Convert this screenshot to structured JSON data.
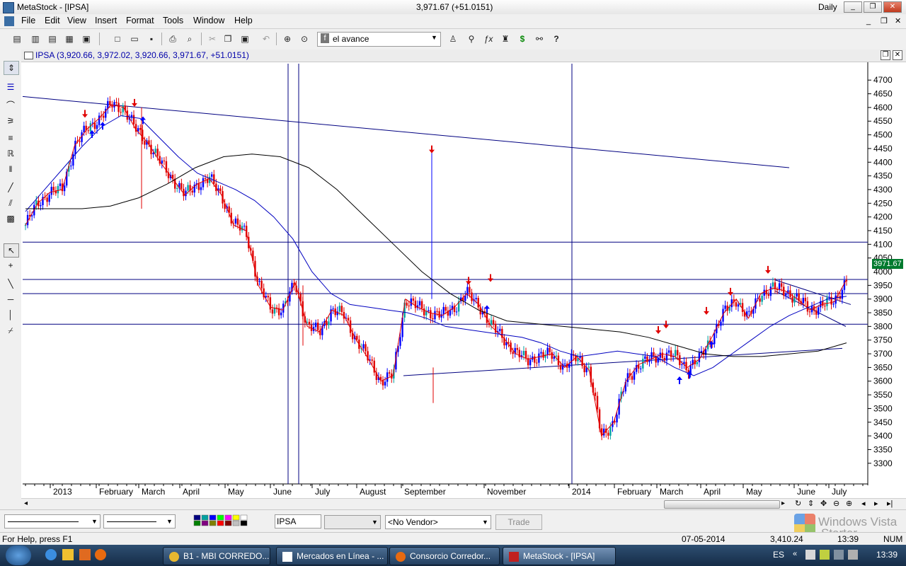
{
  "window": {
    "title": "MetaStock - [IPSA]",
    "quote": "3,971.67 (+51.0151)",
    "period": "Daily",
    "minimize": "_",
    "restore": "❐",
    "close": "✕"
  },
  "menu": [
    "File",
    "Edit",
    "View",
    "Insert",
    "Format",
    "Tools",
    "Window",
    "Help"
  ],
  "toolbar": {
    "template": "el avance",
    "template_icon": "f"
  },
  "chart": {
    "header": "IPSA (3,920.66, 3,972.02, 3,920.66, 3,971.67, +51.0151)",
    "last_price_label": "3971.67",
    "overlap_tick_label": "4000",
    "colors": {
      "up": "#0000ff",
      "down": "#e00000",
      "teal": "#00a0a0",
      "ma_short": "#e00000",
      "ma_mid": "#0000c0",
      "ma_long": "#000000",
      "grid_line": "#000080",
      "last_label_bg": "#007a2e"
    }
  },
  "chart_data": {
    "type": "line",
    "title": "",
    "xlabel": "",
    "ylabel": "",
    "ylim": [
      3240,
      4760
    ],
    "y_ticks": [
      3300,
      3350,
      3400,
      3450,
      3500,
      3550,
      3600,
      3650,
      3700,
      3750,
      3800,
      3850,
      3900,
      3950,
      4050,
      4100,
      4150,
      4200,
      4250,
      4300,
      4350,
      4400,
      4450,
      4500,
      4550,
      4600,
      4650,
      4700
    ],
    "x_labels": [
      "2013",
      "February",
      "March",
      "April",
      "May",
      "June",
      "July",
      "August",
      "September",
      "November",
      "2014",
      "February",
      "March",
      "April",
      "May",
      "June",
      "July"
    ],
    "series": [
      {
        "values": [
          4170,
          4250,
          4290,
          4300,
          4460,
          4520,
          4560,
          4610,
          4600,
          4520,
          4470,
          4400,
          4340,
          4280,
          4320,
          4340,
          4280,
          4170,
          4150,
          3950,
          3870,
          3860,
          3960,
          3800,
          3780,
          3860,
          3840,
          3750,
          3680,
          3600,
          3620,
          3900,
          3870,
          3850,
          3840,
          3870,
          3920,
          3880,
          3800,
          3760,
          3700,
          3680,
          3690,
          3700,
          3650,
          3690,
          3640,
          3400,
          3450,
          3600,
          3660,
          3680,
          3700,
          3690,
          3650,
          3680,
          3760,
          3850,
          3900,
          3830,
          3920,
          3940,
          3930,
          3900,
          3860,
          3880,
          3890,
          3971.67
        ]
      },
      {
        "values": [
          4220,
          4300,
          4380,
          4460,
          4530,
          4570,
          4560,
          4490,
          4420,
          4360,
          4330,
          4300,
          4260,
          4200,
          4120,
          4000,
          3920,
          3880,
          3870,
          3860,
          3850,
          3830,
          3800,
          3790,
          3780,
          3770,
          3760,
          3740,
          3710,
          3690,
          3700,
          3710,
          3700,
          3690,
          3650,
          3620,
          3650,
          3700,
          3750,
          3800,
          3840,
          3870,
          3900,
          3910
        ]
      },
      {
        "values": [
          4230,
          4230,
          4230,
          4240,
          4270,
          4320,
          4380,
          4420,
          4430,
          4420,
          4380,
          4300,
          4200,
          4100,
          4000,
          3920,
          3860,
          3820,
          3810,
          3800,
          3790,
          3780,
          3760,
          3730,
          3700,
          3690,
          3690,
          3700,
          3710,
          3740
        ]
      }
    ],
    "trend_lines": [
      {
        "from": [
          "2013-01",
          4640
        ],
        "to": [
          "2014-06",
          4380
        ]
      },
      {
        "from": [
          "2013-08",
          3620
        ],
        "to": [
          "2014-07",
          3720
        ]
      },
      {
        "from": [
          "2014-05",
          3970
        ],
        "to": [
          "2014-07",
          3880
        ]
      },
      {
        "from": [
          "2014-05",
          3930
        ],
        "to": [
          "2014-07",
          3800
        ]
      }
    ],
    "horizontal_lines": [
      4108,
      3971.67,
      3920,
      3808
    ],
    "vertical_lines": [
      "June 2013",
      "June 2013",
      "2014"
    ],
    "grid": false,
    "legend": "none"
  },
  "bottom": {
    "symbol": "IPSA",
    "vendor": "<No Vendor>",
    "trade": "Trade",
    "scroll_left": "◂",
    "scroll_right": "▸"
  },
  "status": {
    "help": "For Help, press F1",
    "date": "07-05-2014",
    "value": "3,410.24",
    "time": "13:39",
    "num": "NUM"
  },
  "taskbar": {
    "tasks": [
      {
        "label": "B1 - MBI CORREDO...",
        "icon_color": "#e8b830"
      },
      {
        "label": "Mercados en Línea - ...",
        "icon_color": "#ffffff"
      },
      {
        "label": "Consorcio Corredor...",
        "icon_color": "#e86a10"
      },
      {
        "label": "MetaStock - [IPSA]",
        "icon_color": "#c02020"
      }
    ],
    "lang": "ES",
    "clock": "13:39"
  },
  "watermark": {
    "line1": "Windows Vista",
    "line2": "Starter"
  }
}
